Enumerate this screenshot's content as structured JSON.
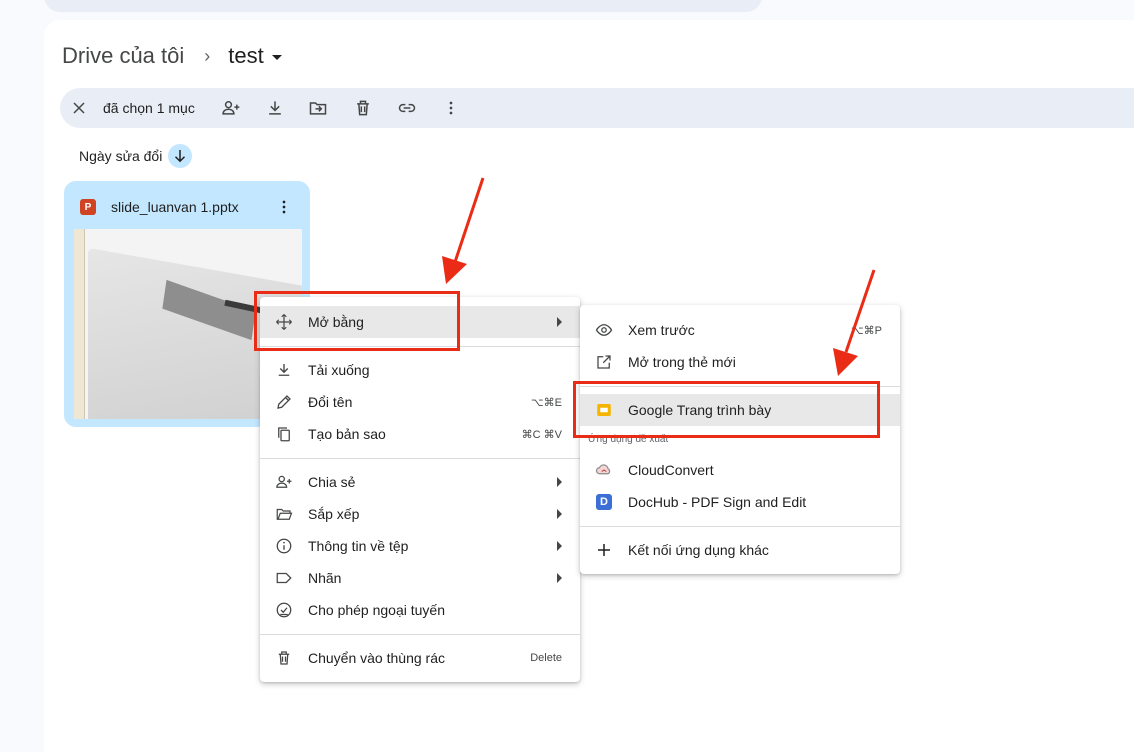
{
  "breadcrumb": {
    "root": "Drive của tôi",
    "separator": "›",
    "current": "test"
  },
  "selection_bar": {
    "count_text": "đã chọn 1 mục",
    "actions": [
      "close-icon",
      "share-icon",
      "download-icon",
      "move-icon",
      "trash-icon",
      "link-icon",
      "more-icon"
    ]
  },
  "sort": {
    "label": "Ngày sửa đổi",
    "direction": "down"
  },
  "file": {
    "name": "slide_luanvan 1.pptx",
    "type_badge": "P"
  },
  "context_menu": {
    "open_with": "Mở bằng",
    "download": "Tải xuống",
    "rename": "Đổi tên",
    "rename_shortcut": "⌥⌘E",
    "copy": "Tạo bản sao",
    "copy_shortcut": "⌘C ⌘V",
    "share": "Chia sẻ",
    "organize": "Sắp xếp",
    "file_info": "Thông tin về tệp",
    "labels": "Nhãn",
    "offline": "Cho phép ngoại tuyến",
    "trash": "Chuyển vào thùng rác",
    "trash_shortcut": "Delete"
  },
  "submenu": {
    "preview": "Xem trước",
    "preview_shortcut": "⌥⌘P",
    "open_new_tab": "Mở trong thẻ mới",
    "google_slides": "Google Trang trình bày",
    "suggested_section": "Ứng dụng đề xuất",
    "cloudconvert": "CloudConvert",
    "dochub": "DocHub - PDF Sign and Edit",
    "dochub_badge": "D",
    "connect_more": "Kết nối ứng dụng khác"
  },
  "colors": {
    "annotation_red": "#ea2c16",
    "selected_blue": "#c2e7ff",
    "slides_yellow": "#f4b400",
    "dochub_blue": "#3b6fd6",
    "ppt_red": "#d04423"
  }
}
